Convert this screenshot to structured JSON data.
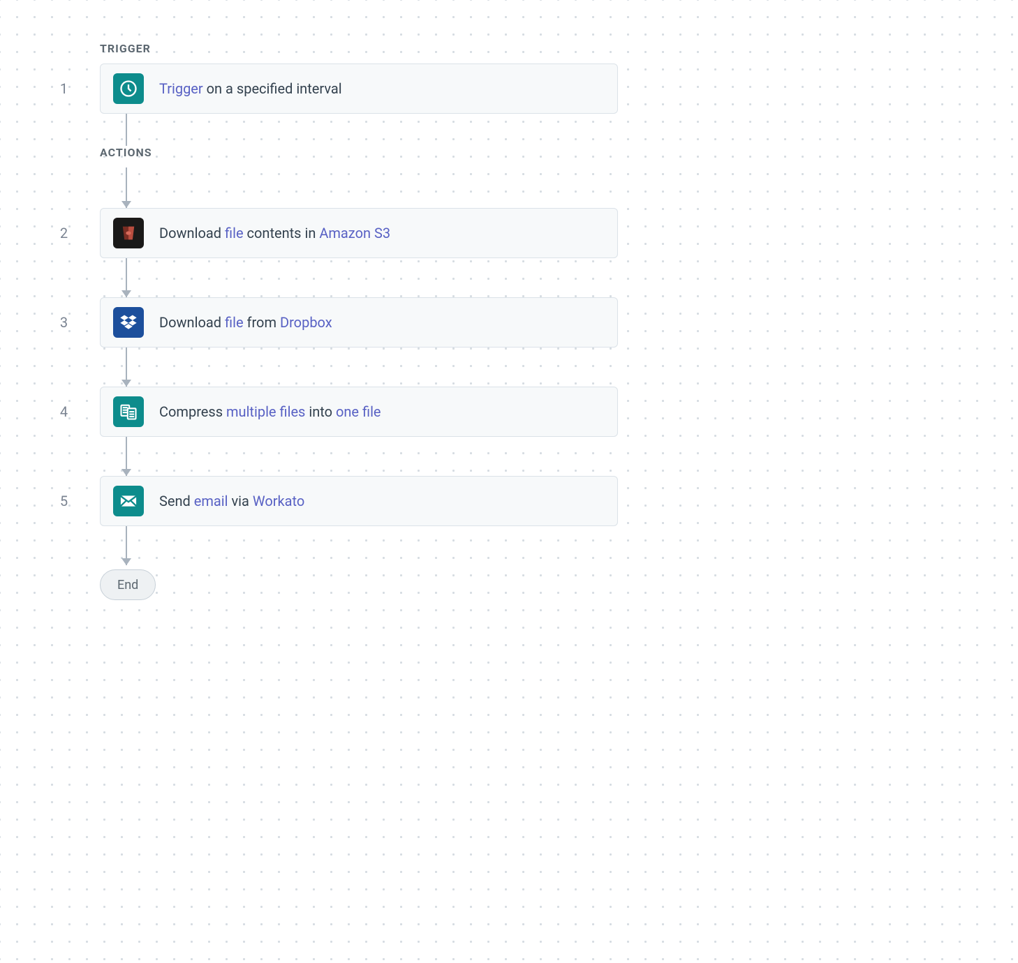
{
  "labels": {
    "trigger_section": "TRIGGER",
    "actions_section": "ACTIONS",
    "end": "End"
  },
  "steps": [
    {
      "num": "1",
      "icon": "clock-icon",
      "icon_class": "icon-teal",
      "parts": [
        {
          "text": "Trigger",
          "accent": true
        },
        {
          "text": " on a specified interval",
          "accent": false
        }
      ]
    },
    {
      "num": "2",
      "icon": "s3-icon",
      "icon_class": "icon-dark",
      "parts": [
        {
          "text": "Download ",
          "accent": false
        },
        {
          "text": "file",
          "accent": true
        },
        {
          "text": " contents in ",
          "accent": false
        },
        {
          "text": "Amazon S3",
          "accent": true
        }
      ]
    },
    {
      "num": "3",
      "icon": "dropbox-icon",
      "icon_class": "icon-blue",
      "parts": [
        {
          "text": "Download ",
          "accent": false
        },
        {
          "text": "file",
          "accent": true
        },
        {
          "text": " from ",
          "accent": false
        },
        {
          "text": "Dropbox",
          "accent": true
        }
      ]
    },
    {
      "num": "4",
      "icon": "files-icon",
      "icon_class": "icon-teal",
      "parts": [
        {
          "text": "Compress ",
          "accent": false
        },
        {
          "text": "multiple files",
          "accent": true
        },
        {
          "text": " into ",
          "accent": false
        },
        {
          "text": "one file",
          "accent": true
        }
      ]
    },
    {
      "num": "5",
      "icon": "mail-icon",
      "icon_class": "icon-teal",
      "parts": [
        {
          "text": "Send ",
          "accent": false
        },
        {
          "text": "email",
          "accent": true
        },
        {
          "text": " via ",
          "accent": false
        },
        {
          "text": "Workato",
          "accent": true
        }
      ]
    }
  ]
}
